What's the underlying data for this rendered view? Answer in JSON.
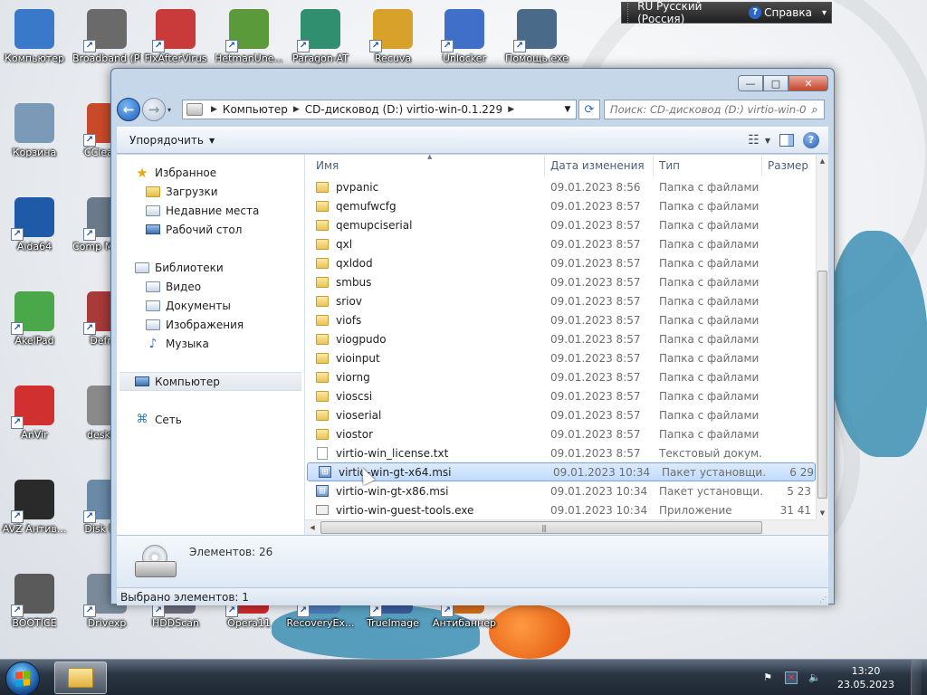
{
  "desktop": {
    "icons": [
      {
        "label": "Компьютер",
        "icon": "computer-icon",
        "color": "#3a78c9"
      },
      {
        "label": "Broadband (PPPoE)",
        "icon": "broadband-icon",
        "color": "#6a6a6a"
      },
      {
        "label": "FixAfterVirus",
        "icon": "fixaftervirus-icon",
        "color": "#c93a3a"
      },
      {
        "label": "HetmanUne...",
        "icon": "hetman-icon",
        "color": "#5a9a3a"
      },
      {
        "label": "Paragon-AT",
        "icon": "paragon-icon",
        "color": "#2f8f6f"
      },
      {
        "label": "Recuva",
        "icon": "recuva-icon",
        "color": "#d7a12a"
      },
      {
        "label": "Unlocker",
        "icon": "unlocker-icon",
        "color": "#3f6fc9"
      },
      {
        "label": "Помощь.exe",
        "icon": "help-exe-icon",
        "color": "#4a6a8a"
      },
      {
        "label": "Корзина",
        "icon": "recycle-bin-icon",
        "color": "#7a9ab8"
      },
      {
        "label": "CCleaner",
        "icon": "ccleaner-icon",
        "color": "#c94a2a"
      },
      {
        "label": "Aida64",
        "icon": "aida64-icon",
        "color": "#1f5aa8"
      },
      {
        "label": "Comp Manage",
        "icon": "computer-management-icon",
        "color": "#6a7a8a"
      },
      {
        "label": "AkelPad",
        "icon": "akelpad-icon",
        "color": "#4aa84a"
      },
      {
        "label": "Defrag",
        "icon": "defrag-icon",
        "color": "#a83a3a"
      },
      {
        "label": "AnVir",
        "icon": "anvir-icon",
        "color": "#d03030"
      },
      {
        "label": "desktop",
        "icon": "desktop-ini-icon",
        "color": "#8a8a8a"
      },
      {
        "label": "AVZ Антив...",
        "icon": "avz-icon",
        "color": "#2a2a2a"
      },
      {
        "label": "Disk Drill",
        "icon": "disk-drill-icon",
        "color": "#6a8aa8"
      },
      {
        "label": "BOOTICE",
        "icon": "bootice-icon",
        "color": "#5a5a5a"
      },
      {
        "label": "Drivexp",
        "icon": "drivexp-icon",
        "color": "#7a8a9a"
      },
      {
        "label": "HDDScan",
        "icon": "hddscan-icon",
        "color": "#6a6a7a"
      },
      {
        "label": "Opera11",
        "icon": "opera-icon",
        "color": "#c92a2a"
      },
      {
        "label": "RecoveryEx...",
        "icon": "recoveryex-icon",
        "color": "#4a7ab8"
      },
      {
        "label": "TrueImage",
        "icon": "trueimage-icon",
        "color": "#3a5a9a"
      },
      {
        "label": "Антибаннер",
        "icon": "antibanner-icon",
        "color": "#d06a1a"
      }
    ]
  },
  "langbar": {
    "language": "RU Русский (Россия)",
    "help": "Справка",
    "help_icon": "help-icon"
  },
  "window": {
    "controls": {
      "minimize": "—",
      "maximize": "□",
      "close": "✕"
    },
    "address": {
      "crumbs": [
        "Компьютер",
        "CD-дисковод (D:) virtio-win-0.1.229"
      ]
    },
    "search": {
      "placeholder": "Поиск: CD-дисковод (D:) virtio-win-0..."
    },
    "toolbar": {
      "organize": "Упорядочить"
    },
    "nav": {
      "favorites": "Избранное",
      "favorites_items": [
        "Загрузки",
        "Недавние места",
        "Рабочий стол"
      ],
      "libraries": "Библиотеки",
      "libraries_items": [
        "Видео",
        "Документы",
        "Изображения",
        "Музыка"
      ],
      "computer": "Компьютер",
      "network": "Сеть"
    },
    "columns": {
      "name": "Имя",
      "date": "Дата изменения",
      "type": "Тип",
      "size": "Размер"
    },
    "files": [
      {
        "name": "pvpanic",
        "date": "09.01.2023 8:56",
        "type": "Папка с файлами",
        "size": "",
        "kind": "folder"
      },
      {
        "name": "qemufwcfg",
        "date": "09.01.2023 8:57",
        "type": "Папка с файлами",
        "size": "",
        "kind": "folder"
      },
      {
        "name": "qemupciserial",
        "date": "09.01.2023 8:57",
        "type": "Папка с файлами",
        "size": "",
        "kind": "folder"
      },
      {
        "name": "qxl",
        "date": "09.01.2023 8:57",
        "type": "Папка с файлами",
        "size": "",
        "kind": "folder"
      },
      {
        "name": "qxldod",
        "date": "09.01.2023 8:57",
        "type": "Папка с файлами",
        "size": "",
        "kind": "folder"
      },
      {
        "name": "smbus",
        "date": "09.01.2023 8:57",
        "type": "Папка с файлами",
        "size": "",
        "kind": "folder"
      },
      {
        "name": "sriov",
        "date": "09.01.2023 8:57",
        "type": "Папка с файлами",
        "size": "",
        "kind": "folder"
      },
      {
        "name": "viofs",
        "date": "09.01.2023 8:57",
        "type": "Папка с файлами",
        "size": "",
        "kind": "folder"
      },
      {
        "name": "viogpudo",
        "date": "09.01.2023 8:57",
        "type": "Папка с файлами",
        "size": "",
        "kind": "folder"
      },
      {
        "name": "vioinput",
        "date": "09.01.2023 8:57",
        "type": "Папка с файлами",
        "size": "",
        "kind": "folder"
      },
      {
        "name": "viorng",
        "date": "09.01.2023 8:57",
        "type": "Папка с файлами",
        "size": "",
        "kind": "folder"
      },
      {
        "name": "vioscsi",
        "date": "09.01.2023 8:57",
        "type": "Папка с файлами",
        "size": "",
        "kind": "folder"
      },
      {
        "name": "vioserial",
        "date": "09.01.2023 8:57",
        "type": "Папка с файлами",
        "size": "",
        "kind": "folder"
      },
      {
        "name": "viostor",
        "date": "09.01.2023 8:57",
        "type": "Папка с файлами",
        "size": "",
        "kind": "folder"
      },
      {
        "name": "virtio-win_license.txt",
        "date": "09.01.2023 8:57",
        "type": "Текстовый докум...",
        "size": "",
        "kind": "txt"
      },
      {
        "name": "virtio-win-gt-x64.msi",
        "date": "09.01.2023 10:34",
        "type": "Пакет установщи...",
        "size": "6 29",
        "kind": "msi",
        "selected": true
      },
      {
        "name": "virtio-win-gt-x86.msi",
        "date": "09.01.2023 10:34",
        "type": "Пакет установщи...",
        "size": "5 23",
        "kind": "msi"
      },
      {
        "name": "virtio-win-guest-tools.exe",
        "date": "09.01.2023 10:34",
        "type": "Приложение",
        "size": "31 41",
        "kind": "exe"
      }
    ],
    "details": {
      "count": "Элементов: 26"
    },
    "status": {
      "selected": "Выбрано элементов: 1"
    }
  },
  "taskbar": {
    "clock_time": "13:20",
    "clock_date": "23.05.2023"
  }
}
